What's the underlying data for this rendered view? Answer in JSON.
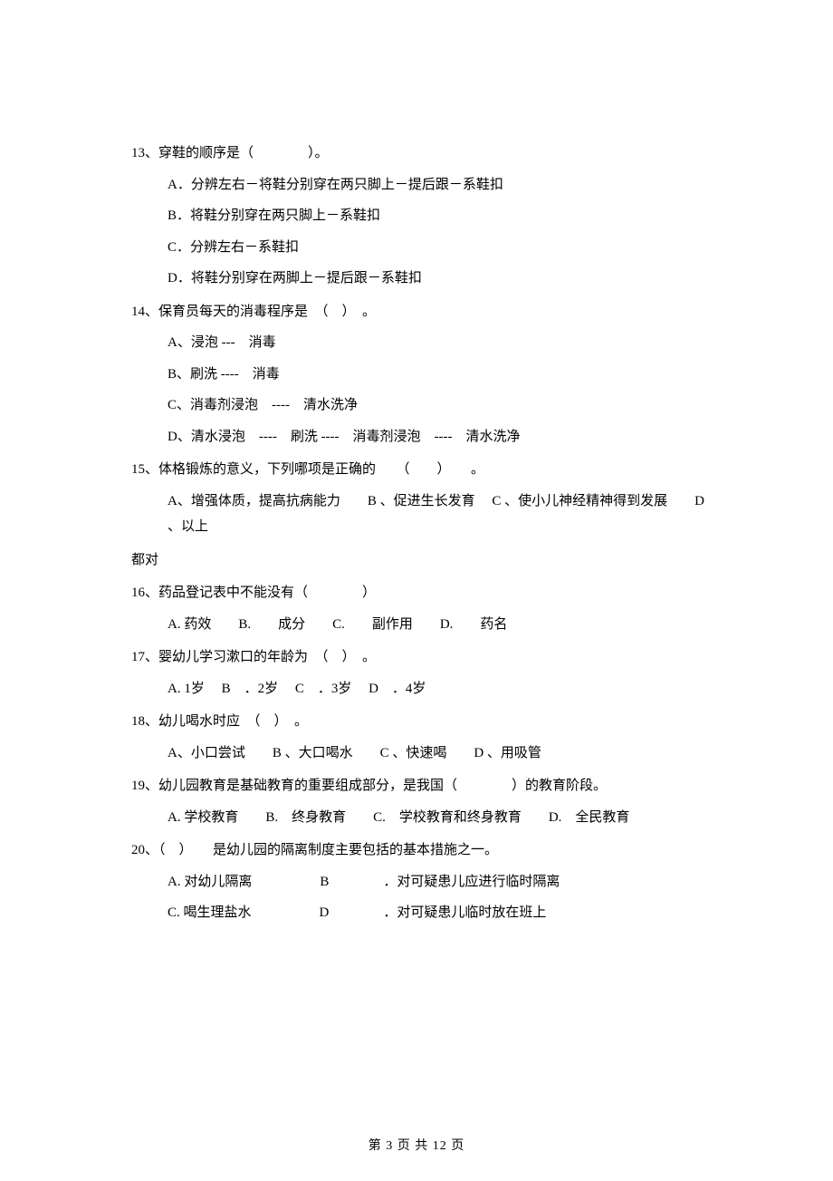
{
  "q13": {
    "stem": "13、穿鞋的顺序是（　　　　）。",
    "A": "A．分辨左右－将鞋分别穿在两只脚上－提后跟－系鞋扣",
    "B": "B．将鞋分别穿在两只脚上－系鞋扣",
    "C": "C．分辨左右－系鞋扣",
    "D": "D．将鞋分别穿在两脚上－提后跟－系鞋扣"
  },
  "q14": {
    "stem": "14、保育员每天的消毒程序是　（　）　。",
    "A": "A、浸泡 ---　消毒",
    "B": "B、刷洗 ----　消毒",
    "C": "C、消毒剂浸泡　----　清水洗净",
    "D": "D、清水浸泡　----　刷洗 ----　消毒剂浸泡　----　清水洗净"
  },
  "q15": {
    "stem": "15、体格锻炼的意义，下列哪项是正确的　　（　　）　　。",
    "opts": "A、增强体质，提高抗病能力　　B 、促进生长发育　 C 、使小儿神经精神得到发展　　D 、以上",
    "cont": "都对"
  },
  "q16": {
    "stem": "16、药品登记表中不能没有（　　　　）",
    "opts": "A.  药效　　B.　　成分　　C.　　副作用　　D.　　药名"
  },
  "q17": {
    "stem": "17、婴幼儿学习漱口的年龄为　（　）　。",
    "opts": "A.  1岁　 B　．2岁　 C　．3岁　 D　．4岁"
  },
  "q18": {
    "stem": "18、幼儿喝水时应　（　）　。",
    "opts": "A、小口尝试　　B 、大口喝水　　C 、快速喝　　D 、用吸管"
  },
  "q19": {
    "stem": "19、幼儿园教育是基础教育的重要组成部分，是我国（　　　　）的教育阶段。",
    "opts": "A.  学校教育　　B.　终身教育　　C.　学校教育和终身教育　　D.　全民教育"
  },
  "q20": {
    "stem": "20、（　）　　是幼儿园的隔离制度主要包括的基本措施之一。",
    "A": "A.  对幼儿隔离　　　　　B　　　　．对可疑患儿应进行临时隔离",
    "C": "C.  喝生理盐水　　　　　D　　　　．对可疑患儿临时放在班上"
  },
  "footer": "第  3  页 共  12  页"
}
